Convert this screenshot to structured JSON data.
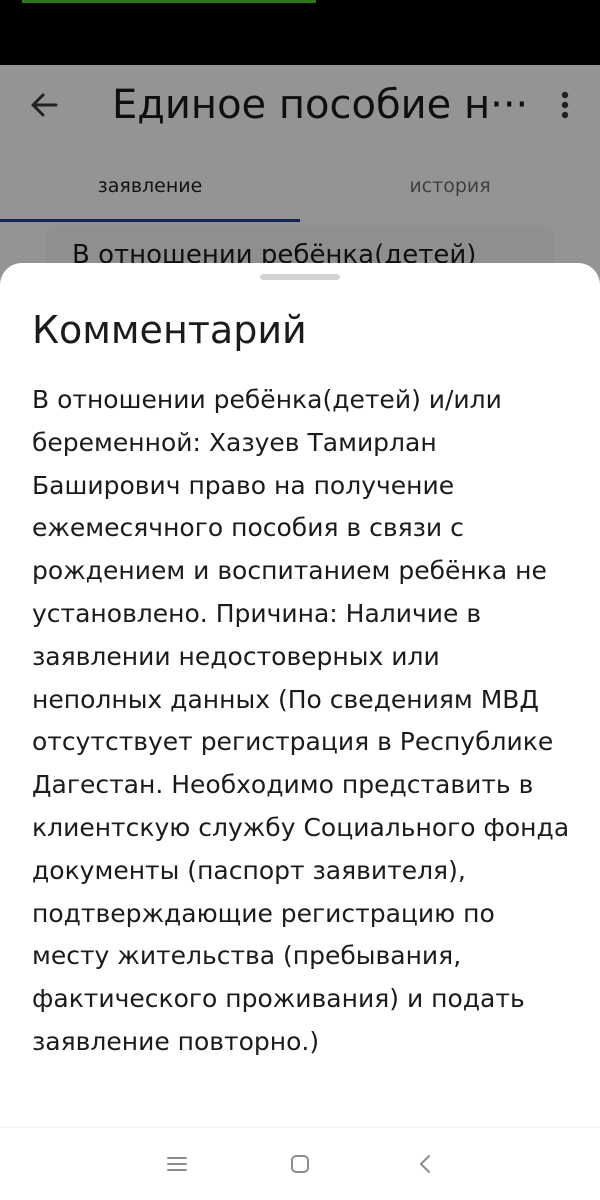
{
  "appbar": {
    "title": "Единое пособие н···",
    "icons": {
      "back": "arrow-left-icon",
      "menu": "more-vertical-icon"
    }
  },
  "tabs": [
    {
      "label": "заявление",
      "selected": true
    },
    {
      "label": "история",
      "selected": false
    }
  ],
  "background_card": {
    "text": "В отношении ребёнка(детей)"
  },
  "sheet": {
    "title": "Комментарий",
    "text": "В отношении ребёнка(детей) и/или беременной: Хазуев Тамирлан Баширович право на получение ежемесячного пособия в связи с рождением и воспитанием ребёнка не установлено. Причина: Наличие в заявлении недостоверных или неполных данных (По сведениям МВД отсутствует регистрация в Республике Дагестан. Необходимо представить в клиентскую службу Социального фонда документы (паспорт заявителя), подтверждающие регистрацию по месту жительства (пребывания, фактического проживания) и подать заявление повторно.)"
  },
  "system_nav": {
    "icons": [
      "menu-icon",
      "home-icon",
      "back-icon"
    ]
  },
  "colors": {
    "accent": "#1f3f8c",
    "status_accent": "#4bd12a"
  }
}
